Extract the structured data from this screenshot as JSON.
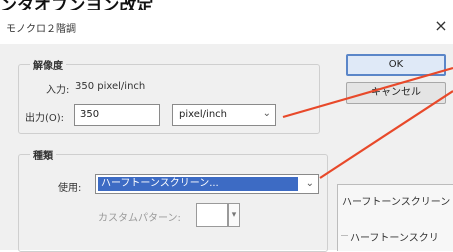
{
  "heading": "ンタオフンヨン改定",
  "window": {
    "title": "モノクロ２階調",
    "close": "×"
  },
  "resolution": {
    "group_label": "解像度",
    "input_label": "入力:",
    "input_value": "350 pixel/inch",
    "output_label": "出力(O):",
    "output_value": "350",
    "unit_value": "pixel/inch"
  },
  "type": {
    "group_label": "種類",
    "method_label": "使用:",
    "method_value": "ハーフトーンスクリーン...",
    "custom_pattern_label": "カスタムパターン:"
  },
  "buttons": {
    "ok": "OK",
    "cancel": "キャンセル"
  },
  "second_dialog": {
    "title": "ハーフトーンスクリーン",
    "group_label": "ハーフトーンスクリ"
  },
  "colors": {
    "callout_line": "#e8492a",
    "selection": "#3d6bc4"
  }
}
